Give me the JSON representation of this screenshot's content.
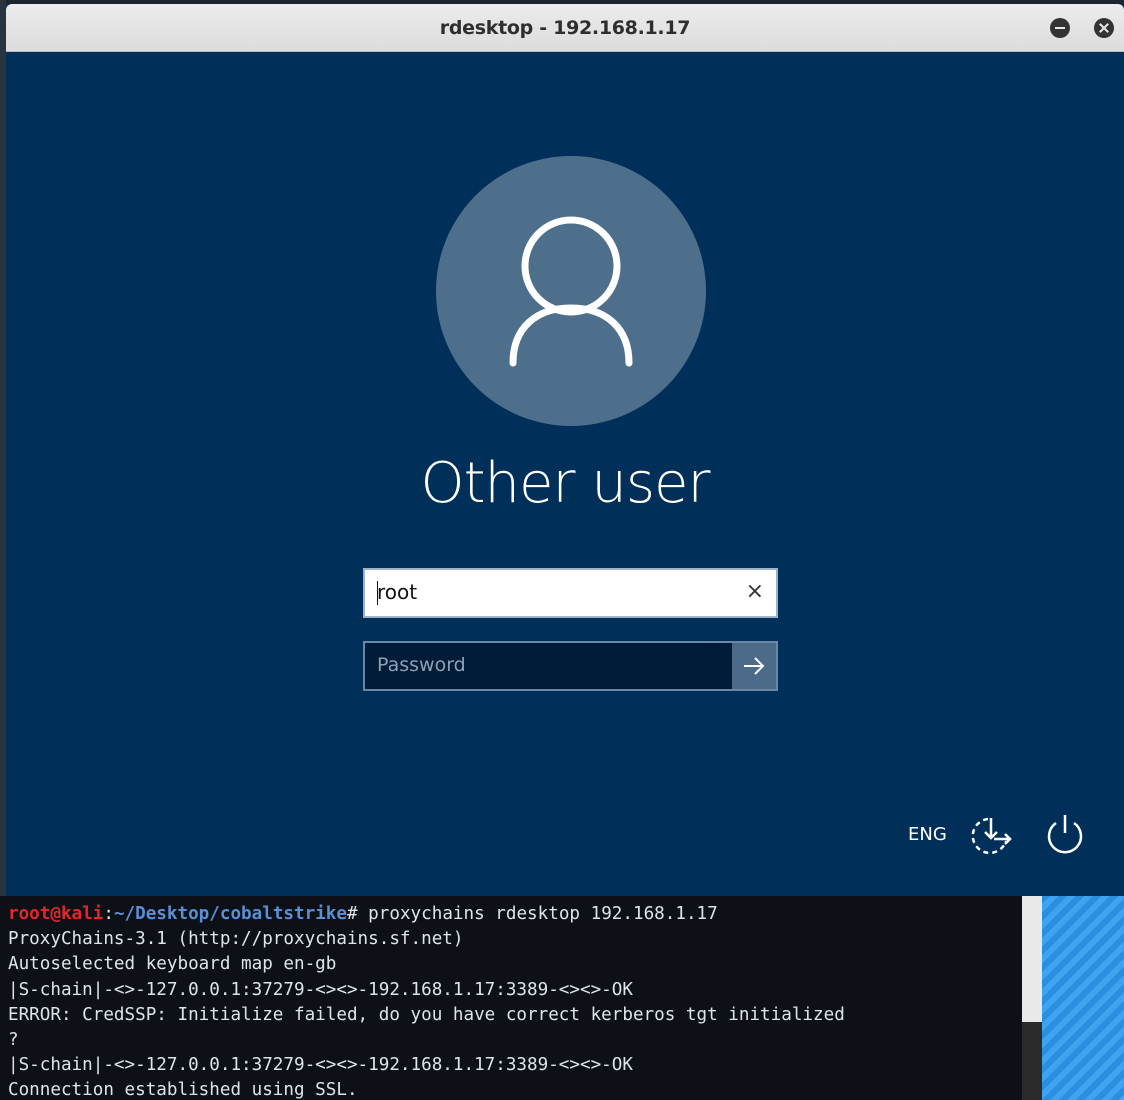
{
  "window": {
    "title": "rdesktop - 192.168.1.17"
  },
  "login": {
    "user_name": "Other user",
    "username_value": "root",
    "clear_glyph": "×",
    "password_placeholder": "Password",
    "language": "ENG"
  },
  "icons": {
    "user": "user-silhouette-icon",
    "clear": "close-icon",
    "submit": "arrow-right-icon",
    "accessibility": "ease-of-access-icon",
    "power": "power-icon"
  },
  "terminal": {
    "prompt_user": "root@kali",
    "prompt_sep": ":",
    "prompt_path": "~/Desktop/cobaltstrike",
    "prompt_cmd": "# proxychains rdesktop 192.168.1.17",
    "lines": [
      "ProxyChains-3.1 (http://proxychains.sf.net)",
      "Autoselected keyboard map en-gb",
      "|S-chain|-<>-127.0.0.1:37279-<><>-192.168.1.17:3389-<><>-OK",
      "ERROR: CredSSP: Initialize failed, do you have correct kerberos tgt initialized",
      "?",
      "|S-chain|-<>-127.0.0.1:37279-<><>-192.168.1.17:3389-<><>-OK",
      "Connection established using SSL."
    ]
  },
  "colors": {
    "login_bg": "#00305a",
    "avatar_bg": "#4d6f8b",
    "terminal_bg": "#0d1117",
    "prompt_user": "#e2262b",
    "prompt_path": "#5a8fd6"
  }
}
